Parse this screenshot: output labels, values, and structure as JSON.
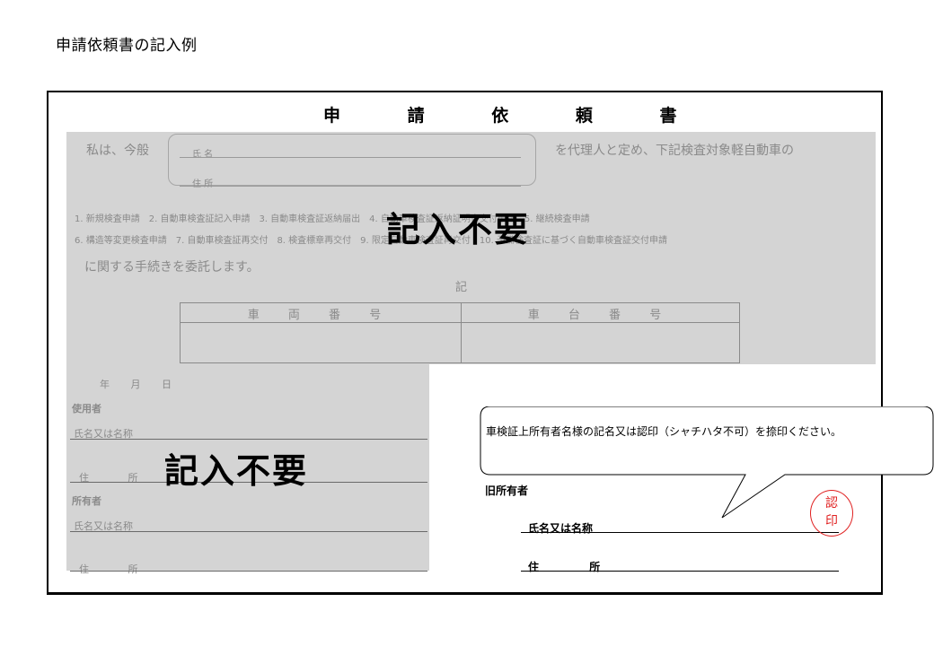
{
  "page": {
    "title": "申請依頼書の記入例"
  },
  "form": {
    "title": "申 請 依 頼 書",
    "intro": "私は、今般",
    "name_label": "氏 名",
    "address_label": "住 所",
    "proxy_text": "を代理人と定め、下記検査対象軽自動車の",
    "applications_row1": "1. 新規検査申請　2. 自動車検査証記入申請　3. 自動車検査証返納届出　4. 自動車検査証返納証明書交付申請　5. 継続検査申請",
    "applications_row2": "6. 構造等変更検査申請　7. 自動車検査証再交付　8. 検査標章再交付　9. 限定自動車検査証再交付　10. 予備検査証に基づく自動車検査証交付申請",
    "entrust_text": "に関する手続きを委託します。",
    "ki_mark": "記",
    "vehicle_table": {
      "col_vehicle_number": "車 両 番 号",
      "col_chassis_number": "車 台 番 号"
    },
    "date_row": "年 月 日",
    "user_section": {
      "heading": "使用者",
      "name_label": "氏名又は名称",
      "address_label": "住 所"
    },
    "owner_section": {
      "heading": "所有者",
      "name_label": "氏名又は名称",
      "address_label": "住 所"
    },
    "previous_owner_section": {
      "heading": "旧所有者",
      "name_label": "氏名又は名称",
      "address_label": "住 所"
    }
  },
  "annotations": {
    "not_required_top": "記入不要",
    "not_required_left": "記入不要",
    "callout_text": "車検証上所有者名様の記名又は認印（シャチハタ不可）を捺印ください。",
    "seal_top": "認",
    "seal_bottom": "印",
    "seal_color": "#e02020"
  }
}
